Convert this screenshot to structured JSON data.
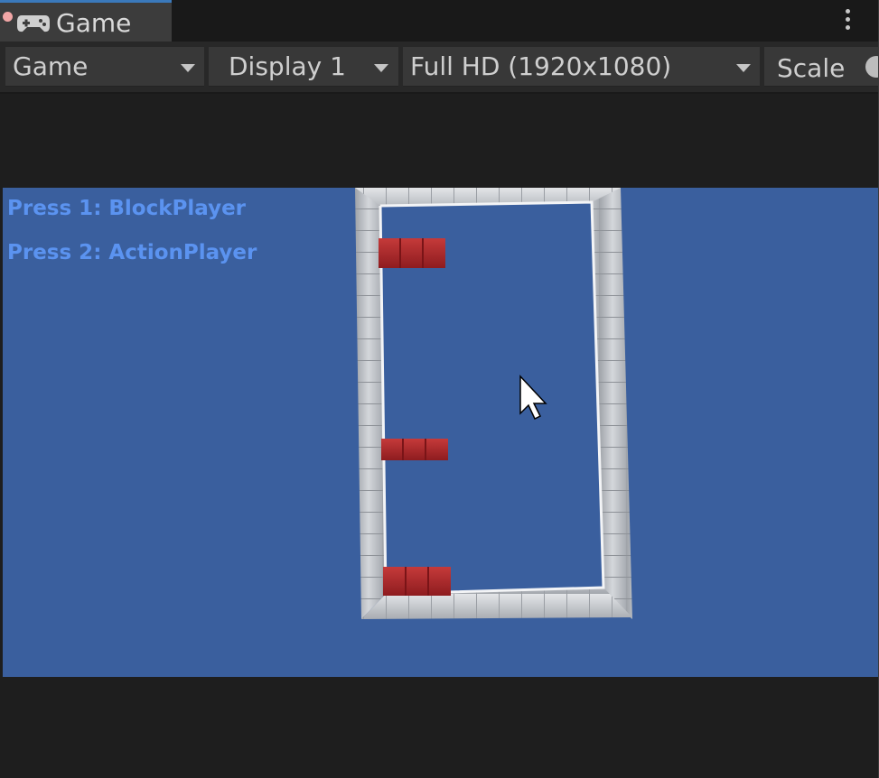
{
  "window": {
    "tab_label": "Game",
    "tab_icon": "gamepad-icon",
    "menu_icon": "kebab-menu-icon"
  },
  "toolbar": {
    "view_mode": "Game",
    "display": "Display 1",
    "resolution": "Full HD (1920x1080)",
    "scale_label": "Scale"
  },
  "game": {
    "hud_line_1": "Press 1: BlockPlayer",
    "hud_line_2": "Press 2: ActionPlayer",
    "background_color": "#3a5f9e",
    "hud_color": "#5b93f0",
    "wall_color": "#bfc3c8",
    "player_block_color": "#b3262a",
    "player_block_count": 3
  },
  "colors": {
    "tab_accent": "#3a79bb",
    "toolbar_bg": "#282828",
    "dropdown_bg": "#383838"
  }
}
